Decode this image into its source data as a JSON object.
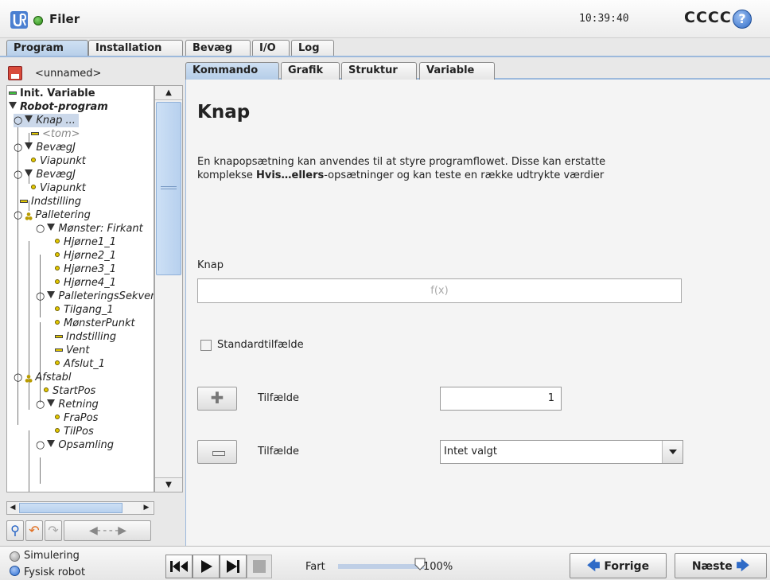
{
  "header": {
    "app_title": "Filer",
    "clock": "10:39:40",
    "robot_name": "CCCC",
    "help_label": "?"
  },
  "top_tabs": [
    {
      "label": "Program",
      "active": true
    },
    {
      "label": "Installation",
      "active": false
    },
    {
      "label": "Bevæg",
      "active": false
    },
    {
      "label": "I/O",
      "active": false
    },
    {
      "label": "Log",
      "active": false
    }
  ],
  "file": {
    "name": "<unnamed>"
  },
  "sub_tabs": [
    {
      "label": "Kommando",
      "active": true
    },
    {
      "label": "Grafik",
      "active": false
    },
    {
      "label": "Struktur",
      "active": false
    },
    {
      "label": "Variable",
      "active": false
    }
  ],
  "tree": [
    {
      "label": "Init. Variable",
      "marker": "dash-green",
      "level": 0,
      "style": "bold"
    },
    {
      "label": "Robot-program",
      "marker": "triangle",
      "level": 0,
      "style": "bold-italic"
    },
    {
      "label": "Knap ...",
      "marker": "triangle",
      "level": 1,
      "style": "italic",
      "selected": true
    },
    {
      "label": "<tom>",
      "marker": "dash",
      "level": 2,
      "style": "italic-grey"
    },
    {
      "label": "BevægJ",
      "marker": "triangle",
      "level": 1,
      "style": "italic"
    },
    {
      "label": "Viapunkt",
      "marker": "dot",
      "level": 2,
      "style": "italic"
    },
    {
      "label": "BevægJ",
      "marker": "triangle",
      "level": 1,
      "style": "italic"
    },
    {
      "label": "Viapunkt",
      "marker": "dot",
      "level": 2,
      "style": "italic"
    },
    {
      "label": "Indstilling",
      "marker": "dash",
      "level": 1,
      "style": "italic"
    },
    {
      "label": "Palletering",
      "marker": "pallet",
      "level": 1,
      "style": "italic"
    },
    {
      "label": "Mønster: Firkant",
      "marker": "triangle",
      "level": 2,
      "style": "italic"
    },
    {
      "label": "Hjørne1_1",
      "marker": "dot",
      "level": 3,
      "style": "italic"
    },
    {
      "label": "Hjørne2_1",
      "marker": "dot",
      "level": 3,
      "style": "italic"
    },
    {
      "label": "Hjørne3_1",
      "marker": "dot",
      "level": 3,
      "style": "italic"
    },
    {
      "label": "Hjørne4_1",
      "marker": "dot",
      "level": 3,
      "style": "italic"
    },
    {
      "label": "PalleteringsSekvens",
      "marker": "triangle",
      "level": 2,
      "style": "italic"
    },
    {
      "label": "Tilgang_1",
      "marker": "dot",
      "level": 3,
      "style": "italic"
    },
    {
      "label": "MønsterPunkt",
      "marker": "dot",
      "level": 3,
      "style": "italic"
    },
    {
      "label": "Indstilling",
      "marker": "dash",
      "level": 3,
      "style": "italic"
    },
    {
      "label": "Vent",
      "marker": "dash",
      "level": 3,
      "style": "italic"
    },
    {
      "label": "Afslut_1",
      "marker": "dot",
      "level": 3,
      "style": "italic"
    },
    {
      "label": "Afstabl",
      "marker": "pallet",
      "level": 1,
      "style": "italic"
    },
    {
      "label": "StartPos",
      "marker": "dot",
      "level": 2,
      "style": "italic"
    },
    {
      "label": "Retning",
      "marker": "triangle",
      "level": 2,
      "style": "italic"
    },
    {
      "label": "FraPos",
      "marker": "dot",
      "level": 3,
      "style": "italic"
    },
    {
      "label": "TilPos",
      "marker": "dot",
      "level": 3,
      "style": "italic"
    },
    {
      "label": "Opsamling",
      "marker": "triangle",
      "level": 2,
      "style": "italic"
    }
  ],
  "main": {
    "title": "Knap",
    "desc_line1": "En knapopsætning kan anvendes til at styre programflowet. Disse kan erstatte",
    "desc_line2_pre": "komplekse ",
    "desc_line2_bold": "Hvis…ellers",
    "desc_line2_post": "-opsætninger og kan teste en række udtrykte værdier",
    "knap_label": "Knap",
    "expr_placeholder": "f(x)",
    "default_case_label": "Standardtilfælde",
    "default_case_checked": false,
    "case_label": "Tilfælde",
    "case_number": "1",
    "case_select_value": "Intet valgt"
  },
  "bottom": {
    "sim_label": "Simulering",
    "real_label": "Fysisk robot",
    "speed_label": "Fart",
    "speed_value": "100%",
    "speed_fraction": 1.0,
    "prev_label": "Forrige",
    "next_label": "Næste"
  },
  "colors": {
    "accent": "#2f6bc7",
    "tab_active": "#b5cde8",
    "status_ok": "#2c8a16"
  }
}
